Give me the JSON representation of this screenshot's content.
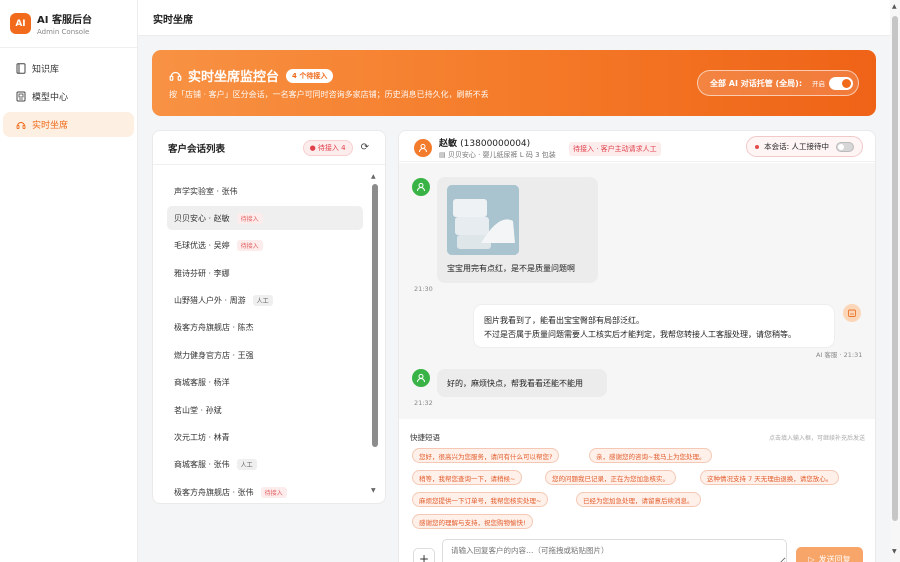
{
  "brand": {
    "logo": "AI",
    "title": "AI 客服后台",
    "subtitle": "Admin Console"
  },
  "nav": {
    "items": [
      {
        "label": "知识库",
        "icon": "book-icon"
      },
      {
        "label": "模型中心",
        "icon": "model-icon"
      },
      {
        "label": "实时坐席",
        "icon": "headset-icon",
        "active": true
      }
    ]
  },
  "topbar": {
    "title": "实时坐席"
  },
  "banner": {
    "title": "实时坐席监控台",
    "pending_pill": "4 个待接入",
    "description": "按「店铺 · 客户」区分会话，一名客户可同时咨询多家店铺；历史消息已持久化，刷新不丢",
    "toggle_label": "全部 AI 对话托管 (全局):",
    "toggle_state": "开启"
  },
  "list_panel": {
    "title": "客户会话列表",
    "pending_badge": "待接入 4",
    "items": [
      {
        "label": "声学实验室 · 张伟",
        "tag": ""
      },
      {
        "label": "贝贝安心 · 赵敏",
        "tag": "待接入",
        "selected": true
      },
      {
        "label": "毛球优选 · 吴婷",
        "tag": "待接入"
      },
      {
        "label": "雅诗芬研 · 李娜",
        "tag": ""
      },
      {
        "label": "山野猎人户外 · 周游",
        "tag": "人工"
      },
      {
        "label": "极客方舟旗舰店 · 陈杰",
        "tag": ""
      },
      {
        "label": "燃力健身官方店 · 王强",
        "tag": ""
      },
      {
        "label": "商城客服 · 杨洋",
        "tag": ""
      },
      {
        "label": "茗山堂 · 孙斌",
        "tag": ""
      },
      {
        "label": "次元工坊 · 林青",
        "tag": ""
      },
      {
        "label": "商城客服 · 张伟",
        "tag": "人工"
      },
      {
        "label": "极客方舟旗舰店 · 张伟",
        "tag": "待接入"
      }
    ]
  },
  "chat": {
    "customer_name": "赵敏",
    "customer_phone": "(13800000004)",
    "customer_sub": "贝贝安心 · 婴儿纸尿裤 L 码 3 包装",
    "status_tag": "待接入 · 客户主动请求人工",
    "session_control": "本会话: 人工接待中",
    "messages": [
      {
        "from": "customer",
        "text": "宝宝用完有点红，是不是质量问题啊",
        "time": "21:30"
      },
      {
        "from": "ai",
        "line1": "图片我看到了，能看出宝宝臀部有局部泛红。",
        "line2": "不过是否属于质量问题需要人工核实后才能判定，我帮您转接人工客服处理，请您稍等。",
        "meta": "AI 客服 · 21:31"
      },
      {
        "from": "customer",
        "text": "好的，麻烦快点，帮我看看还能不能用",
        "time": "21:32"
      }
    ]
  },
  "quick_replies": {
    "title": "快捷短语",
    "hint": "点击填入输入框，可继续补充后发送",
    "chips": [
      "您好，很高兴为您服务，请问有什么可以帮您?",
      "亲，感谢您的咨询~我马上为您处理。",
      "稍等，我帮您查询一下，请稍候~",
      "您的问题我已记录，正在为您加急核实。",
      "这种情况支持 7 天无理由退换，请您放心。",
      "麻烦您提供一下订单号，我帮您核实处理~",
      "已经为您加急处理，请留意后续消息。",
      "感谢您的理解与支持，祝您购物愉快!"
    ]
  },
  "composer": {
    "placeholder": "请输入回复客户的内容…（可拖拽或粘贴图片）",
    "send_label": "发送回复"
  },
  "colors": {
    "accent": "#f26a1b",
    "pending": "#e0404a",
    "customer_avatar": "#39b346"
  }
}
